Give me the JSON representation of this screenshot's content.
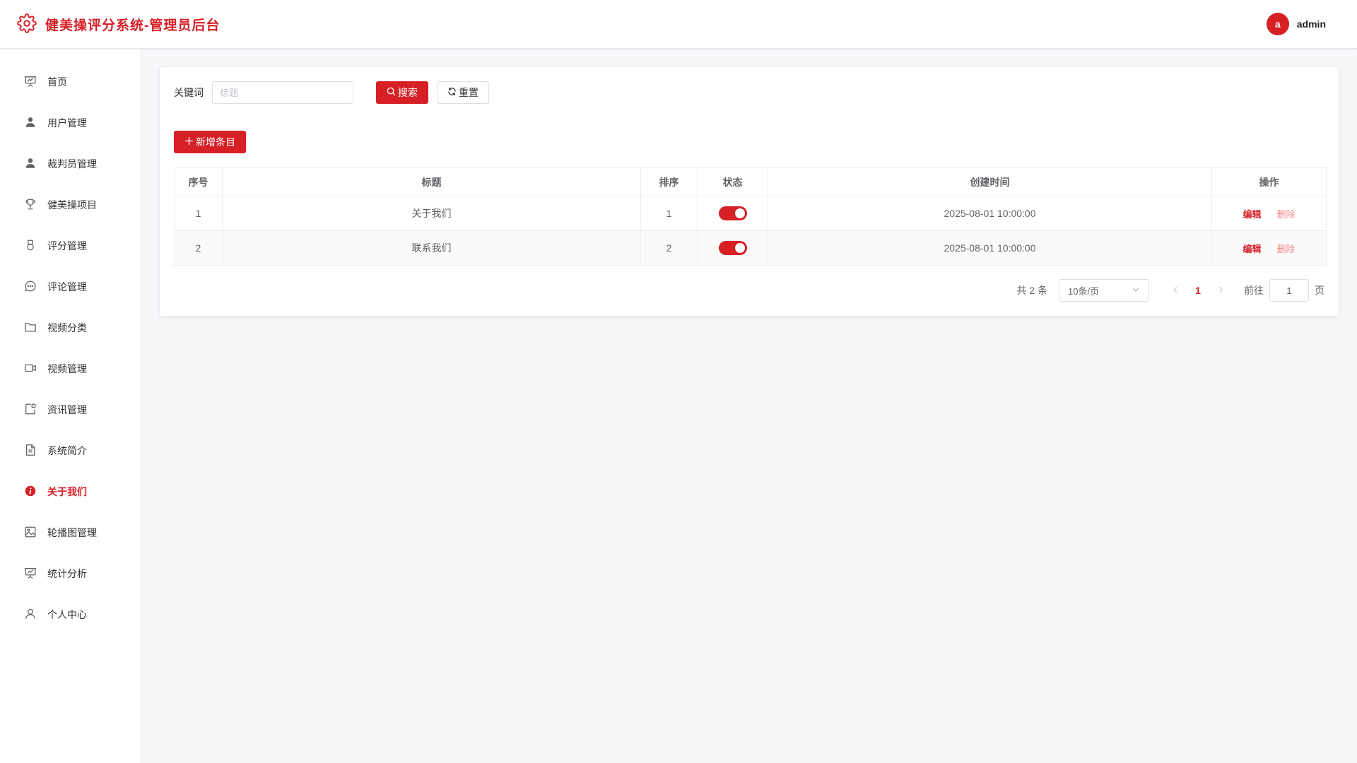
{
  "header": {
    "title": "健美操评分系统-管理员后台",
    "logo_icon": "gear-icon",
    "avatar_letter": "a",
    "username": "admin",
    "accent_color": "#d71f26"
  },
  "sidebar": {
    "items": [
      {
        "label": "首页",
        "icon": "presentation-chart-icon",
        "active": false
      },
      {
        "label": "用户管理",
        "icon": "user-filled-icon",
        "active": false
      },
      {
        "label": "裁判员管理",
        "icon": "user-filled-icon",
        "active": false
      },
      {
        "label": "健美操项目",
        "icon": "trophy-icon",
        "active": false
      },
      {
        "label": "评分管理",
        "icon": "medal-icon",
        "active": false
      },
      {
        "label": "评论管理",
        "icon": "chat-bubble-icon",
        "active": false
      },
      {
        "label": "视频分类",
        "icon": "folder-icon",
        "active": false
      },
      {
        "label": "视频管理",
        "icon": "video-camera-icon",
        "active": false
      },
      {
        "label": "资讯管理",
        "icon": "news-icon",
        "active": false
      },
      {
        "label": "系统简介",
        "icon": "document-icon",
        "active": false
      },
      {
        "label": "关于我们",
        "icon": "info-filled-icon",
        "active": true
      },
      {
        "label": "轮播图管理",
        "icon": "picture-icon",
        "active": false
      },
      {
        "label": "统计分析",
        "icon": "presentation-chart-icon",
        "active": false
      },
      {
        "label": "个人中心",
        "icon": "user-outline-icon",
        "active": false
      }
    ]
  },
  "search": {
    "label": "关键词",
    "placeholder": "标题",
    "value": "",
    "search_button": "搜索",
    "reset_button": "重置"
  },
  "toolbar": {
    "add_button": "新增条目"
  },
  "table": {
    "columns": [
      "序号",
      "标题",
      "排序",
      "状态",
      "创建时间",
      "操作"
    ],
    "rows": [
      {
        "index": "1",
        "title": "关于我们",
        "sort": "1",
        "status_on": true,
        "created": "2025-08-01 10:00:00",
        "edit": "编辑",
        "delete": "删除"
      },
      {
        "index": "2",
        "title": "联系我们",
        "sort": "2",
        "status_on": true,
        "created": "2025-08-01 10:00:00",
        "edit": "编辑",
        "delete": "删除"
      }
    ]
  },
  "pagination": {
    "total": "共 2 条",
    "page_size": "10条/页",
    "current_page": "1",
    "goto_label": "前往",
    "goto_value": "1",
    "page_unit": "页"
  }
}
